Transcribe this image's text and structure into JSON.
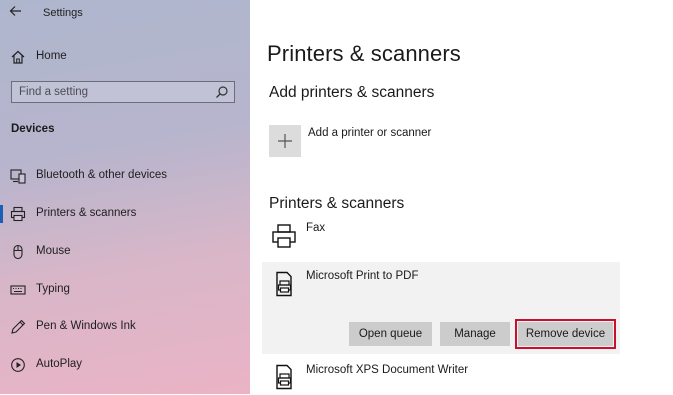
{
  "app": {
    "title": "Settings"
  },
  "sidebar": {
    "home_label": "Home",
    "search": {
      "placeholder": "Find a setting"
    },
    "section_title": "Devices",
    "items": [
      {
        "label": "Bluetooth & other devices",
        "icon": "bluetooth-devices-icon"
      },
      {
        "label": "Printers & scanners",
        "icon": "printer-icon",
        "selected": true
      },
      {
        "label": "Mouse",
        "icon": "mouse-icon"
      },
      {
        "label": "Typing",
        "icon": "keyboard-icon"
      },
      {
        "label": "Pen & Windows Ink",
        "icon": "pen-icon"
      },
      {
        "label": "AutoPlay",
        "icon": "autoplay-icon"
      }
    ]
  },
  "main": {
    "title": "Printers & scanners",
    "add_section": {
      "heading": "Add printers & scanners",
      "add_label": "Add a printer or scanner"
    },
    "list_section": {
      "heading": "Printers & scanners",
      "printers": [
        {
          "name": "Fax"
        },
        {
          "name": "Microsoft Print to PDF",
          "selected": true
        },
        {
          "name": "Microsoft XPS Document Writer"
        }
      ]
    },
    "actions": {
      "open_queue": "Open queue",
      "manage": "Manage",
      "remove_device": "Remove device"
    }
  },
  "colors": {
    "accent": "#1a5fb4",
    "highlight_border": "#c8102e",
    "button_bg": "#cccccc",
    "selected_panel_bg": "#f2f2f2"
  }
}
